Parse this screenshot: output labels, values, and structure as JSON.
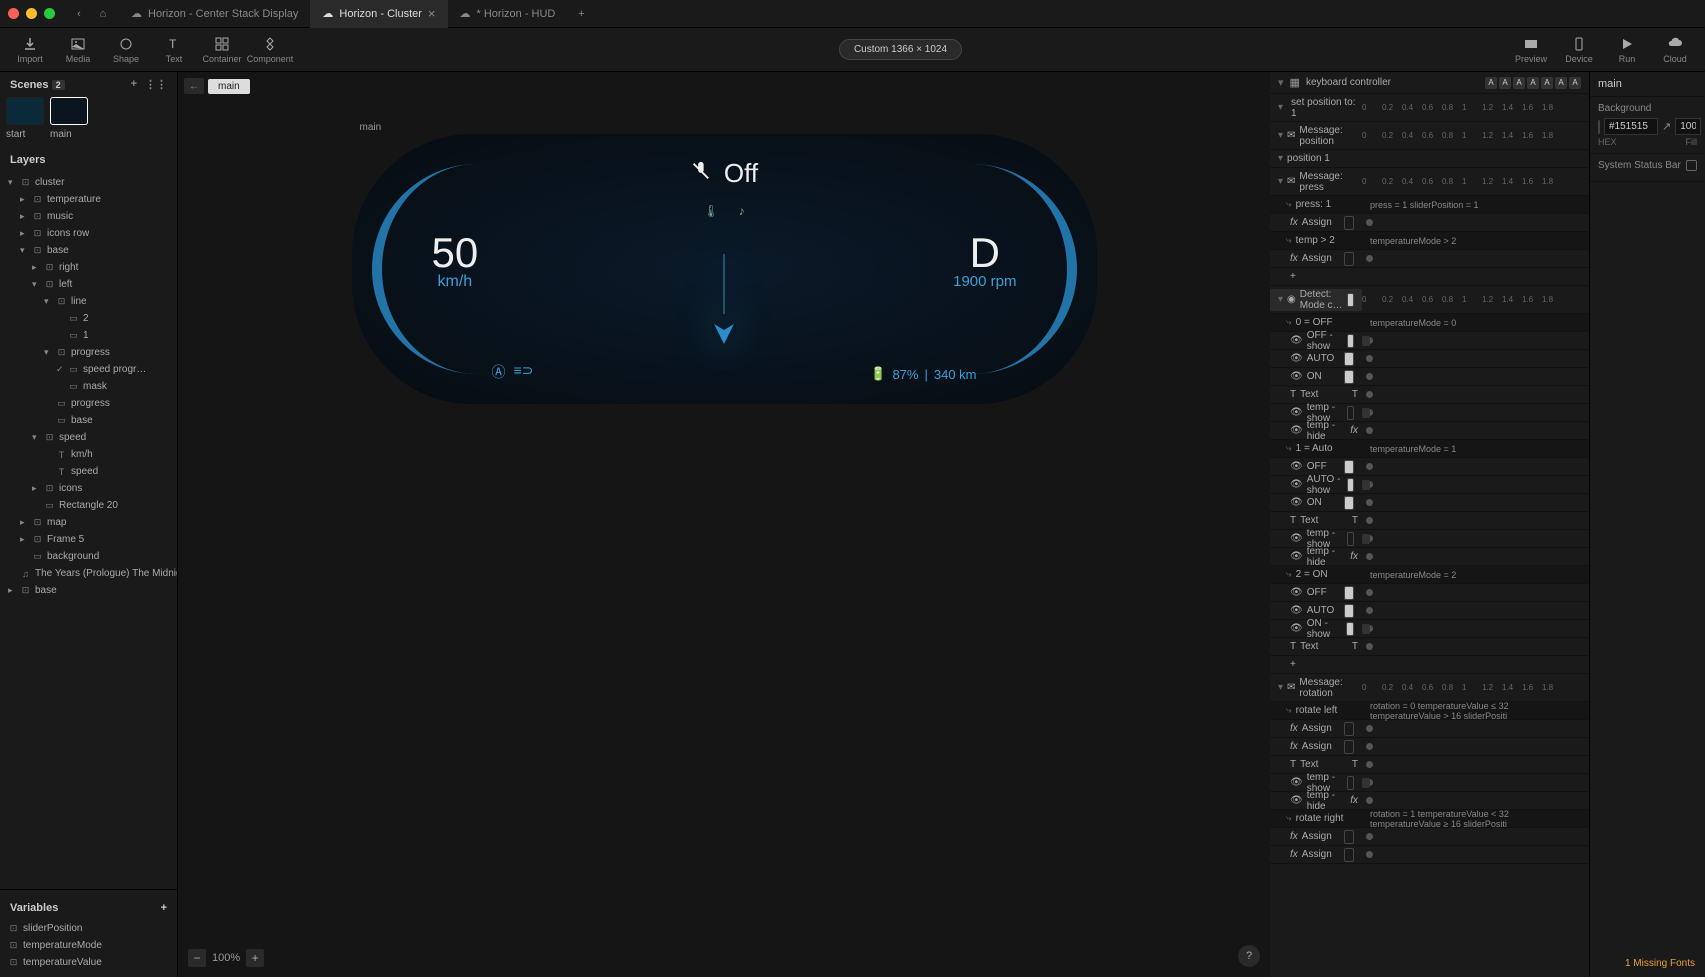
{
  "titlebar": {
    "tabs": [
      {
        "label": "Horizon - Center Stack Display",
        "active": false,
        "dirty": false
      },
      {
        "label": "Horizon - Cluster",
        "active": true,
        "dirty": false
      },
      {
        "label": "* Horizon - HUD",
        "active": false,
        "dirty": true
      }
    ]
  },
  "toolbar": {
    "left": [
      {
        "name": "import",
        "label": "Import"
      },
      {
        "name": "media",
        "label": "Media"
      },
      {
        "name": "shape",
        "label": "Shape"
      },
      {
        "name": "text",
        "label": "Text"
      },
      {
        "name": "container",
        "label": "Container"
      },
      {
        "name": "component",
        "label": "Component"
      }
    ],
    "canvas_size": "Custom 1366 × 1024",
    "right": [
      {
        "name": "preview",
        "label": "Preview"
      },
      {
        "name": "device",
        "label": "Device"
      },
      {
        "name": "run",
        "label": "Run"
      },
      {
        "name": "cloud",
        "label": "Cloud"
      }
    ]
  },
  "scenes": {
    "header": "Scenes",
    "count": "2",
    "items": [
      {
        "name": "start"
      },
      {
        "name": "main"
      }
    ]
  },
  "layers": {
    "header": "Layers",
    "tree": [
      {
        "indent": 0,
        "arrow": "▾",
        "icon": "frame",
        "label": "cluster"
      },
      {
        "indent": 1,
        "arrow": "▸",
        "icon": "frame",
        "label": "temperature"
      },
      {
        "indent": 1,
        "arrow": "▸",
        "icon": "frame",
        "label": "music"
      },
      {
        "indent": 1,
        "arrow": "▸",
        "icon": "frame",
        "label": "icons row"
      },
      {
        "indent": 1,
        "arrow": "▾",
        "icon": "frame",
        "label": "base"
      },
      {
        "indent": 2,
        "arrow": "▸",
        "icon": "frame",
        "label": "right"
      },
      {
        "indent": 2,
        "arrow": "▾",
        "icon": "frame",
        "label": "left"
      },
      {
        "indent": 3,
        "arrow": "▾",
        "icon": "frame",
        "label": "line"
      },
      {
        "indent": 4,
        "arrow": "",
        "icon": "rect",
        "label": "2"
      },
      {
        "indent": 4,
        "arrow": "",
        "icon": "rect",
        "label": "1"
      },
      {
        "indent": 3,
        "arrow": "▾",
        "icon": "frame",
        "label": "progress"
      },
      {
        "indent": 4,
        "arrow": "✓",
        "icon": "rect",
        "label": "speed progr…"
      },
      {
        "indent": 4,
        "arrow": "",
        "icon": "rect",
        "label": "mask"
      },
      {
        "indent": 3,
        "arrow": "",
        "icon": "rect",
        "label": "progress"
      },
      {
        "indent": 3,
        "arrow": "",
        "icon": "rect",
        "label": "base"
      },
      {
        "indent": 2,
        "arrow": "▾",
        "icon": "frame",
        "label": "speed"
      },
      {
        "indent": 3,
        "arrow": "",
        "icon": "text",
        "label": "km/h"
      },
      {
        "indent": 3,
        "arrow": "",
        "icon": "text",
        "label": "speed"
      },
      {
        "indent": 2,
        "arrow": "▸",
        "icon": "frame",
        "label": "icons"
      },
      {
        "indent": 2,
        "arrow": "",
        "icon": "rect",
        "label": "Rectangle 20"
      },
      {
        "indent": 1,
        "arrow": "▸",
        "icon": "frame",
        "label": "map"
      },
      {
        "indent": 1,
        "arrow": "▸",
        "icon": "frame",
        "label": "Frame 5"
      },
      {
        "indent": 1,
        "arrow": "",
        "icon": "rect",
        "label": "background"
      },
      {
        "indent": 0,
        "arrow": "",
        "icon": "music",
        "label": "The Years (Prologue) The Midnight"
      },
      {
        "indent": 0,
        "arrow": "▸",
        "icon": "frame",
        "label": "base"
      }
    ]
  },
  "variables": {
    "header": "Variables",
    "items": [
      {
        "label": "sliderPosition"
      },
      {
        "label": "temperatureMode"
      },
      {
        "label": "temperatureValue"
      }
    ]
  },
  "canvas": {
    "breadcrumb": "main",
    "artboard_label": "main",
    "zoom": "100%",
    "cluster": {
      "off_label": "Off",
      "speed": "50",
      "speed_unit": "km/h",
      "gear": "D",
      "rpm": "1900 rpm",
      "battery_pct": "87%",
      "range": "340 km"
    }
  },
  "timeline": {
    "controller": "keyboard controller",
    "letters": [
      "A",
      "A",
      "A",
      "A",
      "A",
      "A",
      "A"
    ],
    "ruler": [
      "0",
      "0.2",
      "0.4",
      "0.6",
      "0.8",
      "1",
      "1.2",
      "1.4",
      "1.6",
      "1.8"
    ],
    "rows": [
      {
        "type": "ruler-row",
        "label": "set position to: 1"
      },
      {
        "type": "ruler-row",
        "label": "Message: position",
        "icon": "msg"
      },
      {
        "type": "header",
        "label": "position 1"
      },
      {
        "type": "ruler-row",
        "label": "Message: press",
        "icon": "msg"
      },
      {
        "type": "cond",
        "label": "press: 1",
        "desc": "press = 1    sliderPosition = 1"
      },
      {
        "type": "assign",
        "label": "Assign"
      },
      {
        "type": "cond",
        "label": "temp > 2",
        "desc": "temperatureMode > 2"
      },
      {
        "type": "assign",
        "label": "Assign"
      },
      {
        "type": "plus"
      },
      {
        "type": "ruler-row",
        "label": "Detect: Mode c…",
        "icon": "detect",
        "highlight": true
      },
      {
        "type": "cond",
        "label": "0 = OFF",
        "desc": "temperatureMode = 0"
      },
      {
        "type": "track",
        "label": "OFF - show",
        "slot": true,
        "bar": true
      },
      {
        "type": "track",
        "label": "AUTO",
        "slot": true
      },
      {
        "type": "track",
        "label": "ON",
        "slot": true
      },
      {
        "type": "track",
        "label": "Text",
        "icon": "T",
        "textslot": true
      },
      {
        "type": "track",
        "label": "temp - show",
        "slot": false,
        "bar": true
      },
      {
        "type": "track",
        "label": "temp - hide",
        "slot": false,
        "fx": true
      },
      {
        "type": "cond",
        "label": "1 = Auto",
        "desc": "temperatureMode = 1"
      },
      {
        "type": "track",
        "label": "OFF",
        "slot": true
      },
      {
        "type": "track",
        "label": "AUTO - show",
        "slot": true,
        "bar": true
      },
      {
        "type": "track",
        "label": "ON",
        "slot": true
      },
      {
        "type": "track",
        "label": "Text",
        "icon": "T",
        "textslot": true
      },
      {
        "type": "track",
        "label": "temp - show",
        "slot": false,
        "bar": true
      },
      {
        "type": "track",
        "label": "temp - hide",
        "slot": false,
        "fx": true
      },
      {
        "type": "cond",
        "label": "2 = ON",
        "desc": "temperatureMode = 2"
      },
      {
        "type": "track",
        "label": "OFF",
        "slot": true
      },
      {
        "type": "track",
        "label": "AUTO",
        "slot": true
      },
      {
        "type": "track",
        "label": "ON - show",
        "slot": true,
        "bar": true
      },
      {
        "type": "track",
        "label": "Text",
        "icon": "T",
        "textslot": true
      },
      {
        "type": "plus"
      },
      {
        "type": "ruler-row",
        "label": "Message: rotation",
        "icon": "msg"
      },
      {
        "type": "cond",
        "label": "rotate left",
        "desc": "rotation = 0   temperatureValue ≤ 32   temperatureValue > 16   sliderPositi"
      },
      {
        "type": "assign",
        "label": "Assign"
      },
      {
        "type": "assign",
        "label": "Assign"
      },
      {
        "type": "track",
        "label": "Text",
        "icon": "T",
        "textslot": true
      },
      {
        "type": "track",
        "label": "temp - show",
        "slot": false,
        "bar": true
      },
      {
        "type": "track",
        "label": "temp - hide",
        "slot": false,
        "fx": true
      },
      {
        "type": "cond",
        "label": "rotate right",
        "desc": "rotation = 1   temperatureValue < 32   temperatureValue ≥ 16   sliderPositi"
      },
      {
        "type": "assign",
        "label": "Assign"
      },
      {
        "type": "assign",
        "label": "Assign"
      }
    ]
  },
  "inspector": {
    "scene_name": "main",
    "background_label": "Background",
    "background_hex": "#151515",
    "background_alpha": "100",
    "hex_label": "HEX",
    "fill_label": "Fill",
    "system_status_bar": "System Status Bar"
  },
  "footer": {
    "missing_fonts": "1 Missing Fonts"
  }
}
